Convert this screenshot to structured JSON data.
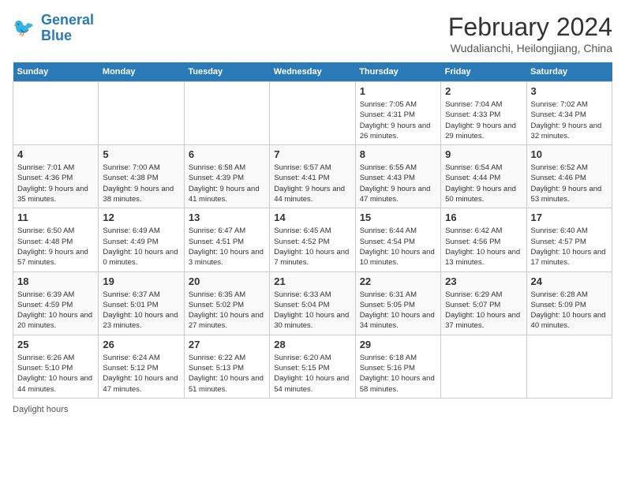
{
  "header": {
    "logo_line1": "General",
    "logo_line2": "Blue",
    "month_year": "February 2024",
    "location": "Wudalianchi, Heilongjiang, China"
  },
  "days_of_week": [
    "Sunday",
    "Monday",
    "Tuesday",
    "Wednesday",
    "Thursday",
    "Friday",
    "Saturday"
  ],
  "weeks": [
    [
      {
        "num": "",
        "info": ""
      },
      {
        "num": "",
        "info": ""
      },
      {
        "num": "",
        "info": ""
      },
      {
        "num": "",
        "info": ""
      },
      {
        "num": "1",
        "info": "Sunrise: 7:05 AM\nSunset: 4:31 PM\nDaylight: 9 hours and 26 minutes."
      },
      {
        "num": "2",
        "info": "Sunrise: 7:04 AM\nSunset: 4:33 PM\nDaylight: 9 hours and 29 minutes."
      },
      {
        "num": "3",
        "info": "Sunrise: 7:02 AM\nSunset: 4:34 PM\nDaylight: 9 hours and 32 minutes."
      }
    ],
    [
      {
        "num": "4",
        "info": "Sunrise: 7:01 AM\nSunset: 4:36 PM\nDaylight: 9 hours and 35 minutes."
      },
      {
        "num": "5",
        "info": "Sunrise: 7:00 AM\nSunset: 4:38 PM\nDaylight: 9 hours and 38 minutes."
      },
      {
        "num": "6",
        "info": "Sunrise: 6:58 AM\nSunset: 4:39 PM\nDaylight: 9 hours and 41 minutes."
      },
      {
        "num": "7",
        "info": "Sunrise: 6:57 AM\nSunset: 4:41 PM\nDaylight: 9 hours and 44 minutes."
      },
      {
        "num": "8",
        "info": "Sunrise: 6:55 AM\nSunset: 4:43 PM\nDaylight: 9 hours and 47 minutes."
      },
      {
        "num": "9",
        "info": "Sunrise: 6:54 AM\nSunset: 4:44 PM\nDaylight: 9 hours and 50 minutes."
      },
      {
        "num": "10",
        "info": "Sunrise: 6:52 AM\nSunset: 4:46 PM\nDaylight: 9 hours and 53 minutes."
      }
    ],
    [
      {
        "num": "11",
        "info": "Sunrise: 6:50 AM\nSunset: 4:48 PM\nDaylight: 9 hours and 57 minutes."
      },
      {
        "num": "12",
        "info": "Sunrise: 6:49 AM\nSunset: 4:49 PM\nDaylight: 10 hours and 0 minutes."
      },
      {
        "num": "13",
        "info": "Sunrise: 6:47 AM\nSunset: 4:51 PM\nDaylight: 10 hours and 3 minutes."
      },
      {
        "num": "14",
        "info": "Sunrise: 6:45 AM\nSunset: 4:52 PM\nDaylight: 10 hours and 7 minutes."
      },
      {
        "num": "15",
        "info": "Sunrise: 6:44 AM\nSunset: 4:54 PM\nDaylight: 10 hours and 10 minutes."
      },
      {
        "num": "16",
        "info": "Sunrise: 6:42 AM\nSunset: 4:56 PM\nDaylight: 10 hours and 13 minutes."
      },
      {
        "num": "17",
        "info": "Sunrise: 6:40 AM\nSunset: 4:57 PM\nDaylight: 10 hours and 17 minutes."
      }
    ],
    [
      {
        "num": "18",
        "info": "Sunrise: 6:39 AM\nSunset: 4:59 PM\nDaylight: 10 hours and 20 minutes."
      },
      {
        "num": "19",
        "info": "Sunrise: 6:37 AM\nSunset: 5:01 PM\nDaylight: 10 hours and 23 minutes."
      },
      {
        "num": "20",
        "info": "Sunrise: 6:35 AM\nSunset: 5:02 PM\nDaylight: 10 hours and 27 minutes."
      },
      {
        "num": "21",
        "info": "Sunrise: 6:33 AM\nSunset: 5:04 PM\nDaylight: 10 hours and 30 minutes."
      },
      {
        "num": "22",
        "info": "Sunrise: 6:31 AM\nSunset: 5:05 PM\nDaylight: 10 hours and 34 minutes."
      },
      {
        "num": "23",
        "info": "Sunrise: 6:29 AM\nSunset: 5:07 PM\nDaylight: 10 hours and 37 minutes."
      },
      {
        "num": "24",
        "info": "Sunrise: 6:28 AM\nSunset: 5:09 PM\nDaylight: 10 hours and 40 minutes."
      }
    ],
    [
      {
        "num": "25",
        "info": "Sunrise: 6:26 AM\nSunset: 5:10 PM\nDaylight: 10 hours and 44 minutes."
      },
      {
        "num": "26",
        "info": "Sunrise: 6:24 AM\nSunset: 5:12 PM\nDaylight: 10 hours and 47 minutes."
      },
      {
        "num": "27",
        "info": "Sunrise: 6:22 AM\nSunset: 5:13 PM\nDaylight: 10 hours and 51 minutes."
      },
      {
        "num": "28",
        "info": "Sunrise: 6:20 AM\nSunset: 5:15 PM\nDaylight: 10 hours and 54 minutes."
      },
      {
        "num": "29",
        "info": "Sunrise: 6:18 AM\nSunset: 5:16 PM\nDaylight: 10 hours and 58 minutes."
      },
      {
        "num": "",
        "info": ""
      },
      {
        "num": "",
        "info": ""
      }
    ]
  ],
  "footer": {
    "daylight_label": "Daylight hours"
  }
}
